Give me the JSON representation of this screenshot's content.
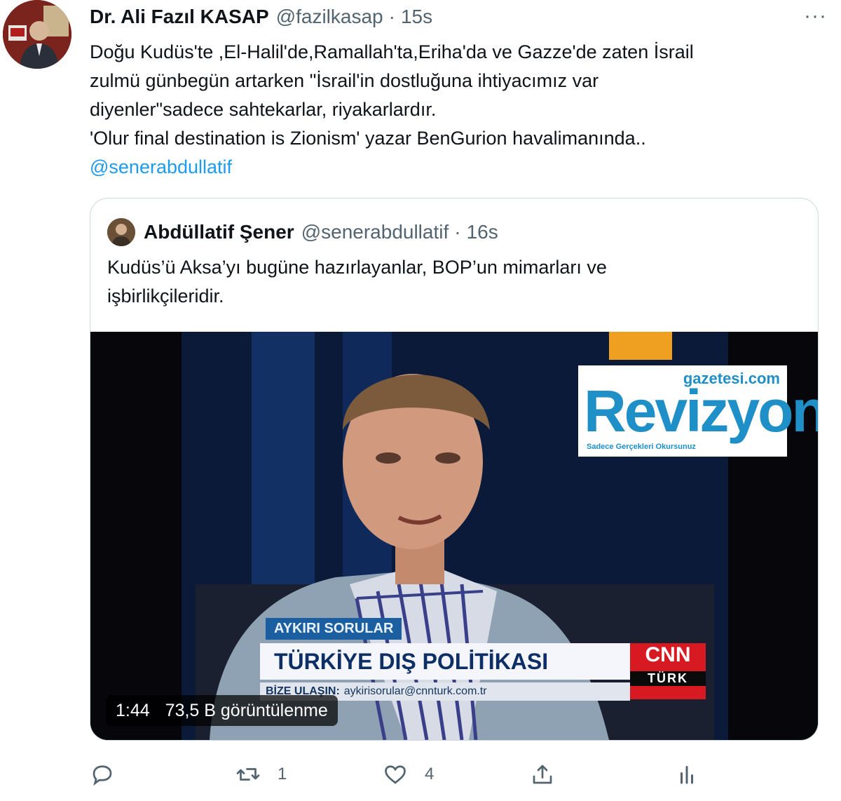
{
  "tweet": {
    "author_name": "Dr. Ali Fazıl KASAP",
    "author_handle": "@fazilkasap",
    "separator": "·",
    "time": "15s",
    "more_label": "···",
    "text_lines": [
      "Doğu Kudüs'te ,El-Halil'de,Ramallah'ta,Eriha'da ve Gazze'de zaten İsrail",
      "zulmü günbegün artarken \"İsrail'in dostluğuna ihtiyacımız var",
      "diyenler\"sadece sahtekarlar, riyakarlardır.",
      "'Olur final destination is Zionism' yazar BenGurion havalimanında.."
    ],
    "mention": "@senerabdullatif"
  },
  "quote": {
    "author_name": "Abdüllatif Şener",
    "author_handle": "@senerabdullatif",
    "separator": "·",
    "time": "16s",
    "text_lines": [
      "Kudüs’ü Aksa’yı bugüne hazırlayanlar, BOP’un mimarları ve",
      "işbirlikçileridir."
    ],
    "video": {
      "duration": "1:44",
      "views": "73,5 B görüntülenme",
      "logo_site": "gazetesi.com",
      "logo_brand": "Revizyon",
      "logo_tagline": "Sadece Gerçekleri Okursunuz",
      "program_name": "AYKIRI SORULAR",
      "headline": "TÜRKİYE DIŞ POLİTİKASI",
      "contact_label": "BİZE ULAŞIN:",
      "contact_email": "aykirisorular@cnnturk.com.tr",
      "channel": "CNN",
      "channel_sub": "TÜRK"
    }
  },
  "actions": {
    "reply": {
      "icon": "reply-icon",
      "count": ""
    },
    "retweet": {
      "icon": "retweet-icon",
      "count": "1"
    },
    "like": {
      "icon": "heart-icon",
      "count": "4"
    },
    "share": {
      "icon": "share-icon"
    },
    "analytics": {
      "icon": "analytics-icon"
    }
  },
  "colors": {
    "link": "#1d9bf0",
    "muted": "#536471",
    "border": "#cfd9de",
    "brand_blue": "#1f8fc8"
  }
}
